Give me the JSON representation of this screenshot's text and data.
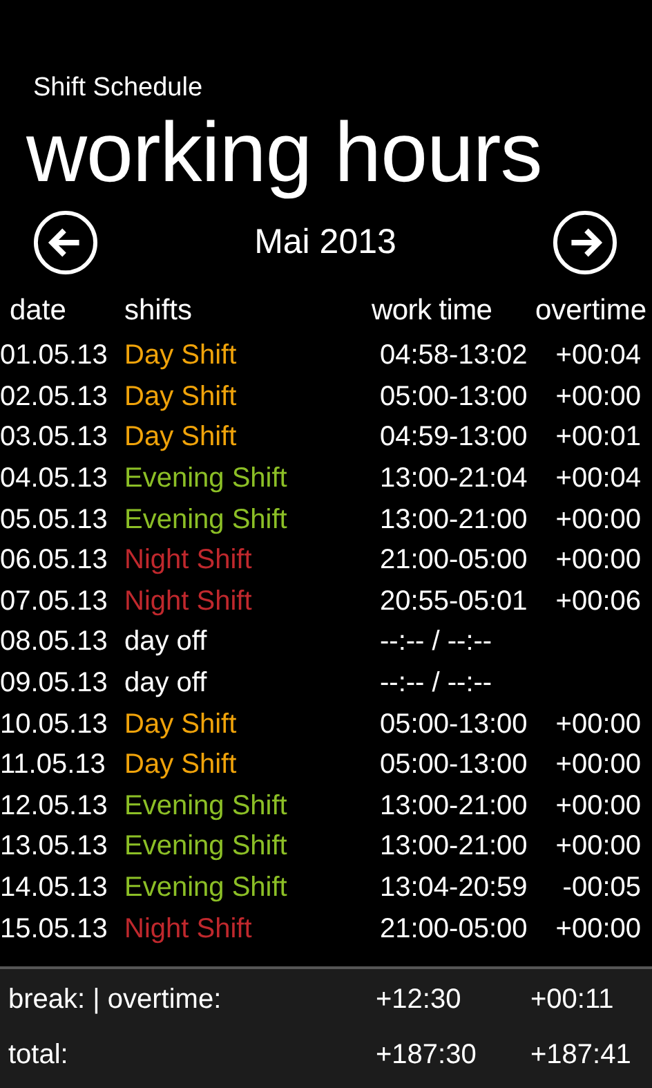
{
  "app_title": "Shift Schedule",
  "page_title": "working hours",
  "nav": {
    "month": "Mai 2013"
  },
  "table": {
    "columns": [
      "date",
      "shifts",
      "work time",
      "overtime"
    ],
    "rows": [
      {
        "date": "01.05.13",
        "shift": "Day Shift",
        "color": "#f0a30a",
        "work_time": "04:58-13:02",
        "overtime": "+00:04"
      },
      {
        "date": "02.05.13",
        "shift": "Day Shift",
        "color": "#f0a30a",
        "work_time": "05:00-13:00",
        "overtime": "+00:00"
      },
      {
        "date": "03.05.13",
        "shift": "Day Shift",
        "color": "#f0a30a",
        "work_time": "04:59-13:00",
        "overtime": "+00:01"
      },
      {
        "date": "04.05.13",
        "shift": "Evening Shift",
        "color": "#8cbf26",
        "work_time": "13:00-21:04",
        "overtime": "+00:04"
      },
      {
        "date": "05.05.13",
        "shift": "Evening Shift",
        "color": "#8cbf26",
        "work_time": "13:00-21:00",
        "overtime": "+00:00"
      },
      {
        "date": "06.05.13",
        "shift": "Night Shift",
        "color": "#c0282d",
        "work_time": "21:00-05:00",
        "overtime": "+00:00"
      },
      {
        "date": "07.05.13",
        "shift": "Night Shift",
        "color": "#c0282d",
        "work_time": "20:55-05:01",
        "overtime": "+00:06"
      },
      {
        "date": "08.05.13",
        "shift": "day off",
        "color": "#ffffff",
        "work_time": "--:-- / --:--"
      },
      {
        "date": "09.05.13",
        "shift": "day off",
        "color": "#ffffff",
        "work_time": "--:-- / --:--"
      },
      {
        "date": "10.05.13",
        "shift": "Day Shift",
        "color": "#f0a30a",
        "work_time": "05:00-13:00",
        "overtime": "+00:00"
      },
      {
        "date": "11.05.13",
        "shift": "Day Shift",
        "color": "#f0a30a",
        "work_time": "05:00-13:00",
        "overtime": "+00:00"
      },
      {
        "date": "12.05.13",
        "shift": "Evening Shift",
        "color": "#8cbf26",
        "work_time": "13:00-21:00",
        "overtime": "+00:00"
      },
      {
        "date": "13.05.13",
        "shift": "Evening Shift",
        "color": "#8cbf26",
        "work_time": "13:00-21:00",
        "overtime": "+00:00"
      },
      {
        "date": "14.05.13",
        "shift": "Evening Shift",
        "color": "#8cbf26",
        "work_time": "13:04-20:59",
        "overtime": "-00:05"
      },
      {
        "date": "15.05.13",
        "shift": "Night Shift",
        "color": "#c0282d",
        "work_time": "21:00-05:00",
        "overtime": "+00:00"
      }
    ]
  },
  "summary": [
    {
      "label": "break: | overtime:",
      "value_1": "+12:30",
      "value_2": "+00:11"
    },
    {
      "label": "total:",
      "value_1": "+187:30",
      "value_2": "+187:41"
    }
  ]
}
